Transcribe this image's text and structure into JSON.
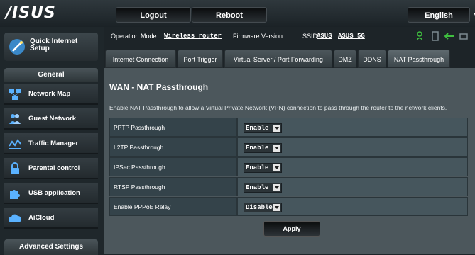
{
  "header": {
    "logo_text": "/ISUS",
    "logout_label": "Logout",
    "reboot_label": "Reboot",
    "language": "English"
  },
  "status_bar": {
    "operation_mode_label": "Operation Mode:",
    "operation_mode_value": "Wireless router",
    "firmware_label": "Firmware Version:",
    "ssid_label": "SSID:",
    "ssid_1": "ASUS",
    "ssid_2": "ASUS_5G"
  },
  "sidebar": {
    "quick_setup": "Quick Internet Setup",
    "general_label": "General",
    "items": [
      {
        "label": "Network Map",
        "icon": "network-map-icon"
      },
      {
        "label": "Guest Network",
        "icon": "guest-network-icon"
      },
      {
        "label": "Traffic Manager",
        "icon": "traffic-manager-icon"
      },
      {
        "label": "Parental control",
        "icon": "parental-control-icon"
      },
      {
        "label": "USB application",
        "icon": "usb-application-icon"
      },
      {
        "label": "AiCloud",
        "icon": "aicloud-icon"
      }
    ],
    "advanced_label": "Advanced Settings"
  },
  "tabs": [
    {
      "label": "Internet Connection"
    },
    {
      "label": "Port Trigger"
    },
    {
      "label": "Virtual Server / Port Forwarding"
    },
    {
      "label": "DMZ"
    },
    {
      "label": "DDNS"
    },
    {
      "label": "NAT Passthrough",
      "active": true
    }
  ],
  "main": {
    "title": "WAN - NAT Passthrough",
    "description": "Enable NAT Passthrough to allow a Virtual Private Network (VPN) connection to pass through the router to the network clients.",
    "settings": [
      {
        "label": "PPTP Passthrough",
        "value": "Enable"
      },
      {
        "label": "L2TP Passthrough",
        "value": "Enable"
      },
      {
        "label": "IPSec Passthrough",
        "value": "Enable"
      },
      {
        "label": "RTSP Passthrough",
        "value": "Enable"
      },
      {
        "label": "Enable PPPoE Relay",
        "value": "Disable"
      }
    ],
    "apply_label": "Apply"
  },
  "colors": {
    "background": "#1d2428",
    "content_panel": "#4c575c",
    "accent_green": "#3fbf3f"
  }
}
